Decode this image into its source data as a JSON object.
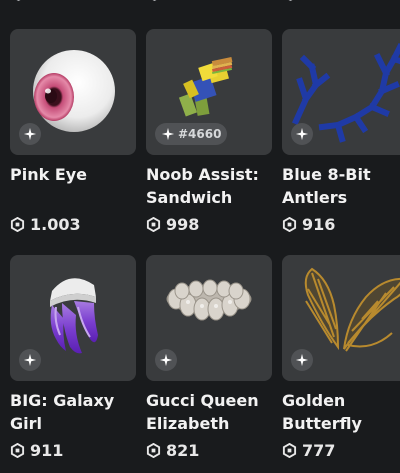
{
  "items": [
    {
      "name_line1": "Pink Eye",
      "name_line2": "",
      "price": "1.003",
      "badge_text": ""
    },
    {
      "name_line1": "Noob Assist:",
      "name_line2": "Sandwich",
      "price": "998",
      "badge_text": "#4660"
    },
    {
      "name_line1": "Blue 8-Bit",
      "name_line2": "Antlers",
      "price": "916",
      "badge_text": ""
    },
    {
      "name_line1": "BIG: Galaxy",
      "name_line2": "Girl",
      "price": "911",
      "badge_text": ""
    },
    {
      "name_line1": "Gucci Queen",
      "name_line2": "Elizabeth",
      "price": "821",
      "badge_text": ""
    },
    {
      "name_line1": "Golden",
      "name_line2": "Butterfly",
      "price": "777",
      "badge_text": ""
    }
  ],
  "icons": {
    "badge": "limited-sparkle-icon",
    "currency": "robux-icon"
  },
  "colors": {
    "background": "#191b1d",
    "card": "#393b3d",
    "badge": "#505255",
    "text": "#f2f2f2"
  }
}
